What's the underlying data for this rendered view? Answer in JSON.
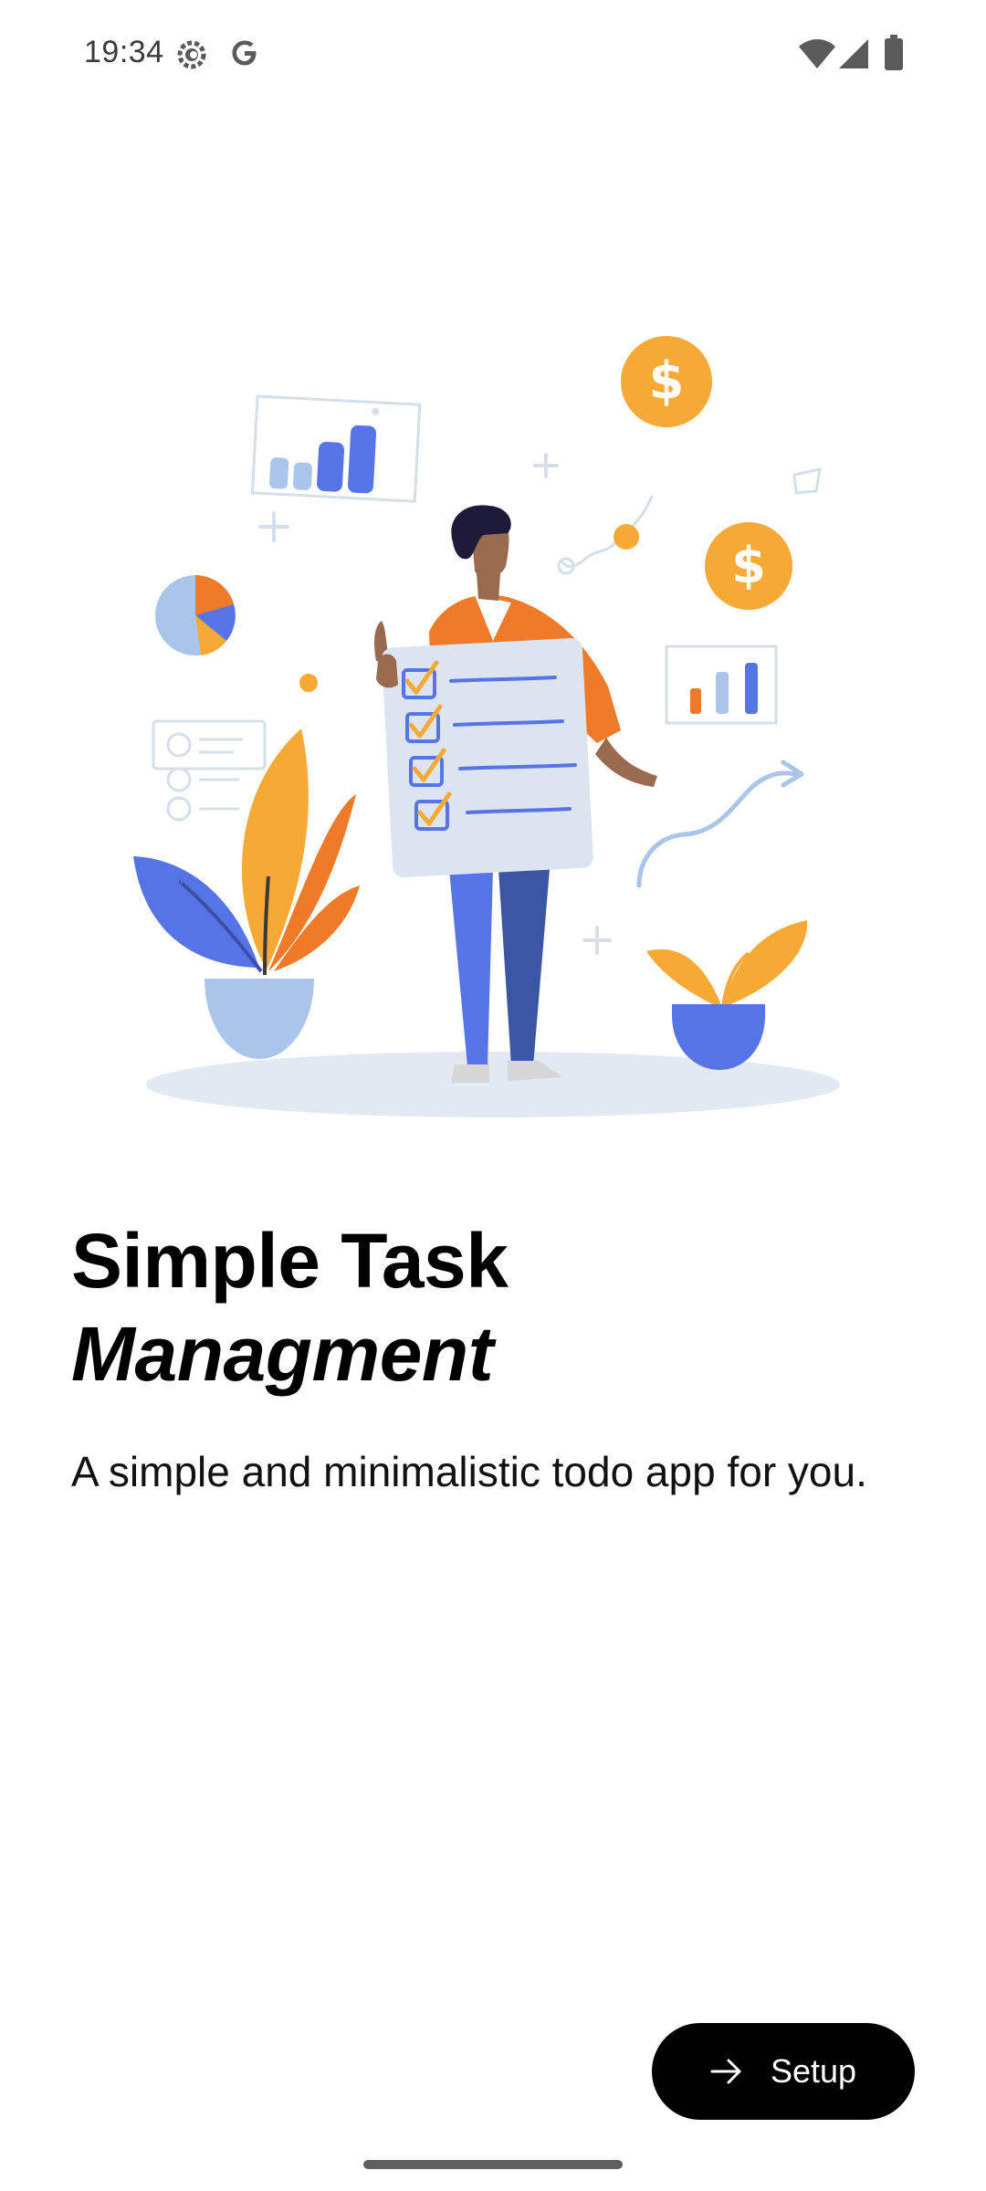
{
  "status_bar": {
    "time": "19:34",
    "icons": [
      "settings-gear-icon",
      "google-g-icon",
      "wifi-icon",
      "cell-signal-icon",
      "battery-icon"
    ]
  },
  "illustration": {
    "description_icon": "task-checklist-illustration"
  },
  "onboarding": {
    "title_line1": "Simple Task",
    "title_line2": "Managment",
    "subtitle": "A simple and minimalistic todo app for you."
  },
  "actions": {
    "setup_label": "Setup",
    "setup_icon": "arrow-right-icon"
  },
  "colors": {
    "accent_orange": "#F7A935",
    "accent_deep_orange": "#EF7B2A",
    "accent_blue": "#5774E6",
    "light_blue": "#A9C6EA",
    "button_bg": "#000000",
    "button_text": "#FFFFFF"
  }
}
